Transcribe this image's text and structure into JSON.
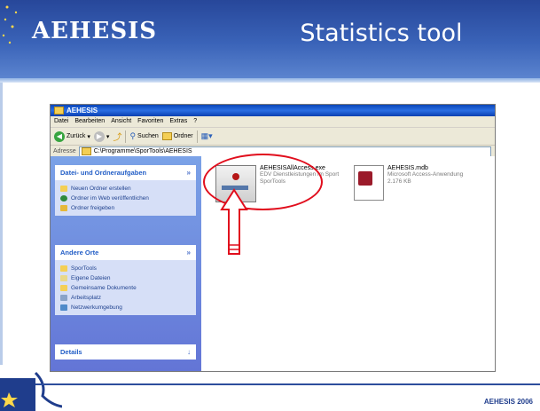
{
  "slide": {
    "brand": "AEHESIS",
    "title": "Statistics tool",
    "footer": "AEHESIS 2006"
  },
  "window": {
    "title": "AEHESIS",
    "menu": [
      "Datei",
      "Bearbeiten",
      "Ansicht",
      "Favoriten",
      "Extras",
      "?"
    ],
    "toolbar": {
      "back_label": "Zurück",
      "search_label": "Suchen",
      "folders_label": "Ordner"
    },
    "address": {
      "label": "Adresse",
      "value": "C:\\Programme\\SporTools\\AEHESIS"
    }
  },
  "sidebar": {
    "tasks": {
      "header": "Datei- und Ordneraufgaben",
      "items": [
        "Neuen Ordner erstellen",
        "Ordner im Web veröffentlichen",
        "Ordner freigeben"
      ]
    },
    "places": {
      "header": "Andere Orte",
      "items": [
        "SporTools",
        "Eigene Dateien",
        "Gemeinsame Dokumente",
        "Arbeitsplatz",
        "Netzwerkumgebung"
      ]
    },
    "details": {
      "header": "Details"
    }
  },
  "files": [
    {
      "name": "AEHESISAllAccess.exe",
      "line1": "EDV Dienstleistungen im Sport",
      "line2": "SporTools",
      "icon": "exe-icon"
    },
    {
      "name": "AEHESIS.mdb",
      "line1": "Microsoft Access-Anwendung",
      "line2": "2.176 KB",
      "icon": "access-db-icon"
    }
  ],
  "colors": {
    "header_blue": "#27479a",
    "highlight_red": "#e10e1d",
    "taskpane_blue": "#6375d6"
  }
}
